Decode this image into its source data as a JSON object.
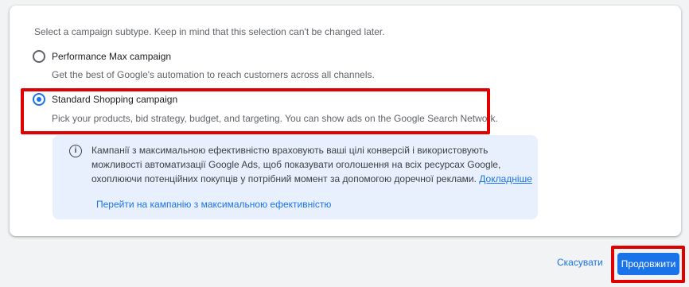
{
  "intro": "Select a campaign subtype. Keep in mind that this selection can't be changed later.",
  "options": [
    {
      "title": "Performance Max campaign",
      "description": "Get the best of Google's automation to reach customers across all channels.",
      "selected": false
    },
    {
      "title": "Standard Shopping campaign",
      "description": "Pick your products, bid strategy, budget, and targeting. You can show ads on the Google Search Network.",
      "selected": true
    }
  ],
  "info": {
    "icon": "info-icon",
    "line1": "Кампанії з максимальною ефективністю враховують ваші цілі конверсій і використовують",
    "line2": "можливості автоматизації Google Ads, щоб показувати оголошення на всіх ресурсах Google,",
    "line3": "охоплюючи потенційних покупців у потрібний момент за допомогою доречної реклами.",
    "learn_more": "Докладніше",
    "switch_link": "Перейти на кампанію з максимальною ефективністю"
  },
  "footer": {
    "cancel_label": "Скасувати",
    "continue_label": "Продовжити"
  },
  "colors": {
    "accent": "#1a73e8",
    "highlight": "#e00000",
    "info_background": "#e8f0fe"
  }
}
